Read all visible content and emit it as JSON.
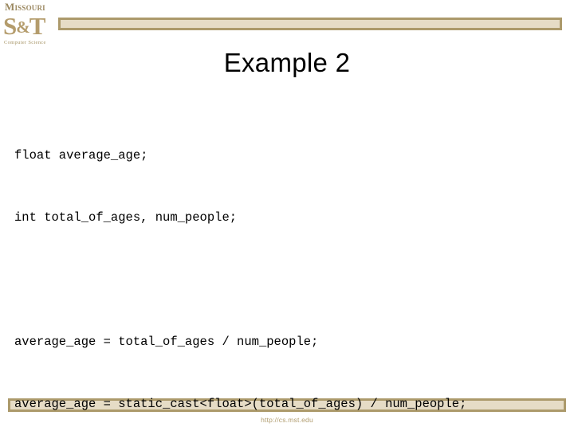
{
  "logo": {
    "university": "Missouri",
    "mark_s": "S",
    "mark_amp": "&",
    "mark_t": "T",
    "department": "Computer Science",
    "color": "#B49C6C"
  },
  "theme": {
    "bar_fill": "#E6DCC6",
    "bar_border": "#AC9A6B",
    "accent": "#B09C6E",
    "background": "#FFFFFF",
    "text": "#000000"
  },
  "slide": {
    "title": "Example 2",
    "code_lines": [
      "float average_age;",
      "int total_of_ages, num_people;",
      "",
      "average_age = total_of_ages / num_people;",
      "average_age = static_cast<float>(total_of_ages) / num_people;"
    ]
  },
  "footer": {
    "url": "http://cs.mst.edu"
  }
}
